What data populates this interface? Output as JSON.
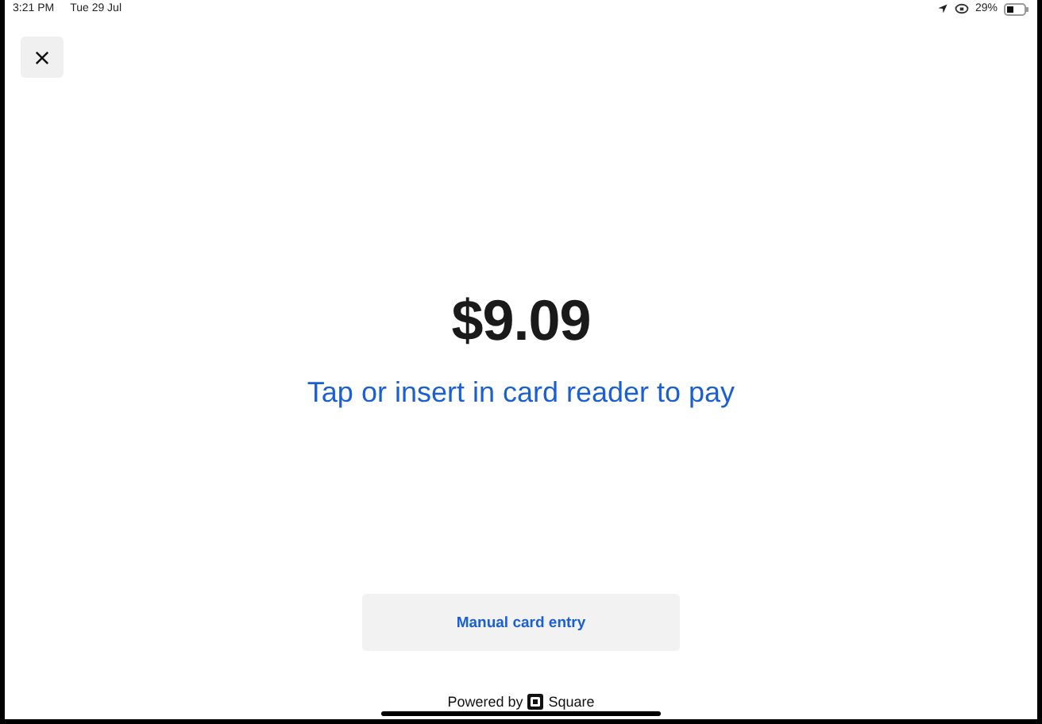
{
  "status_bar": {
    "time": "3:21 PM",
    "date": "Tue 29 Jul",
    "battery_text": "29%"
  },
  "amount": "$9.09",
  "instruction": "Tap or insert in card reader to pay",
  "manual_button": "Manual card entry",
  "footer": {
    "prefix": "Powered by",
    "brand": "Square"
  }
}
